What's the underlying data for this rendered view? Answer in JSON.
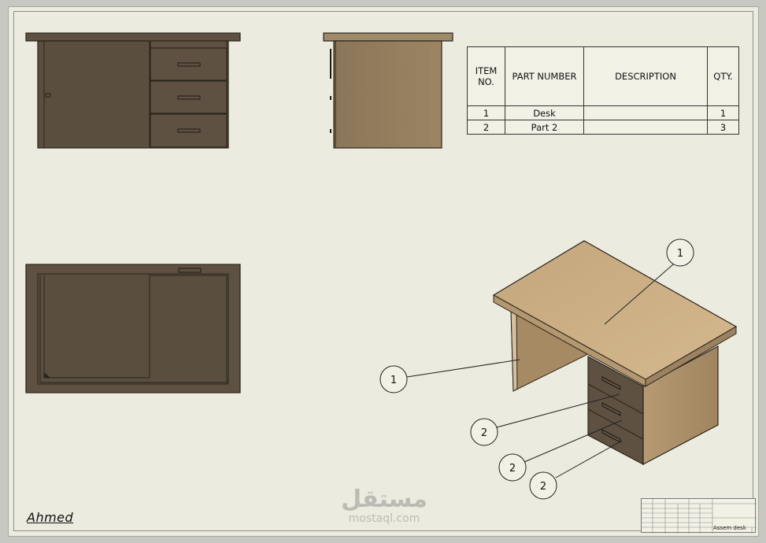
{
  "bom": {
    "headers": {
      "item_no": "ITEM NO.",
      "part_number": "PART NUMBER",
      "description": "DESCRIPTION",
      "qty": "QTY."
    },
    "rows": [
      {
        "item_no": "1",
        "part_number": "Desk",
        "description": "",
        "qty": "1"
      },
      {
        "item_no": "2",
        "part_number": "Part 2",
        "description": "",
        "qty": "3"
      }
    ]
  },
  "balloons": {
    "b1": "1",
    "b2": "1",
    "b3": "2",
    "b4": "2",
    "b5": "2"
  },
  "author": "Ahmed",
  "watermark": {
    "logo": "مستقل",
    "site": "mostaql.com"
  },
  "title_block": {
    "drawing_name": "Assem desk"
  },
  "colors": {
    "dark_wood": "#5e5141",
    "light_wood": "#c8a87c",
    "paper": "#ecebdf"
  }
}
